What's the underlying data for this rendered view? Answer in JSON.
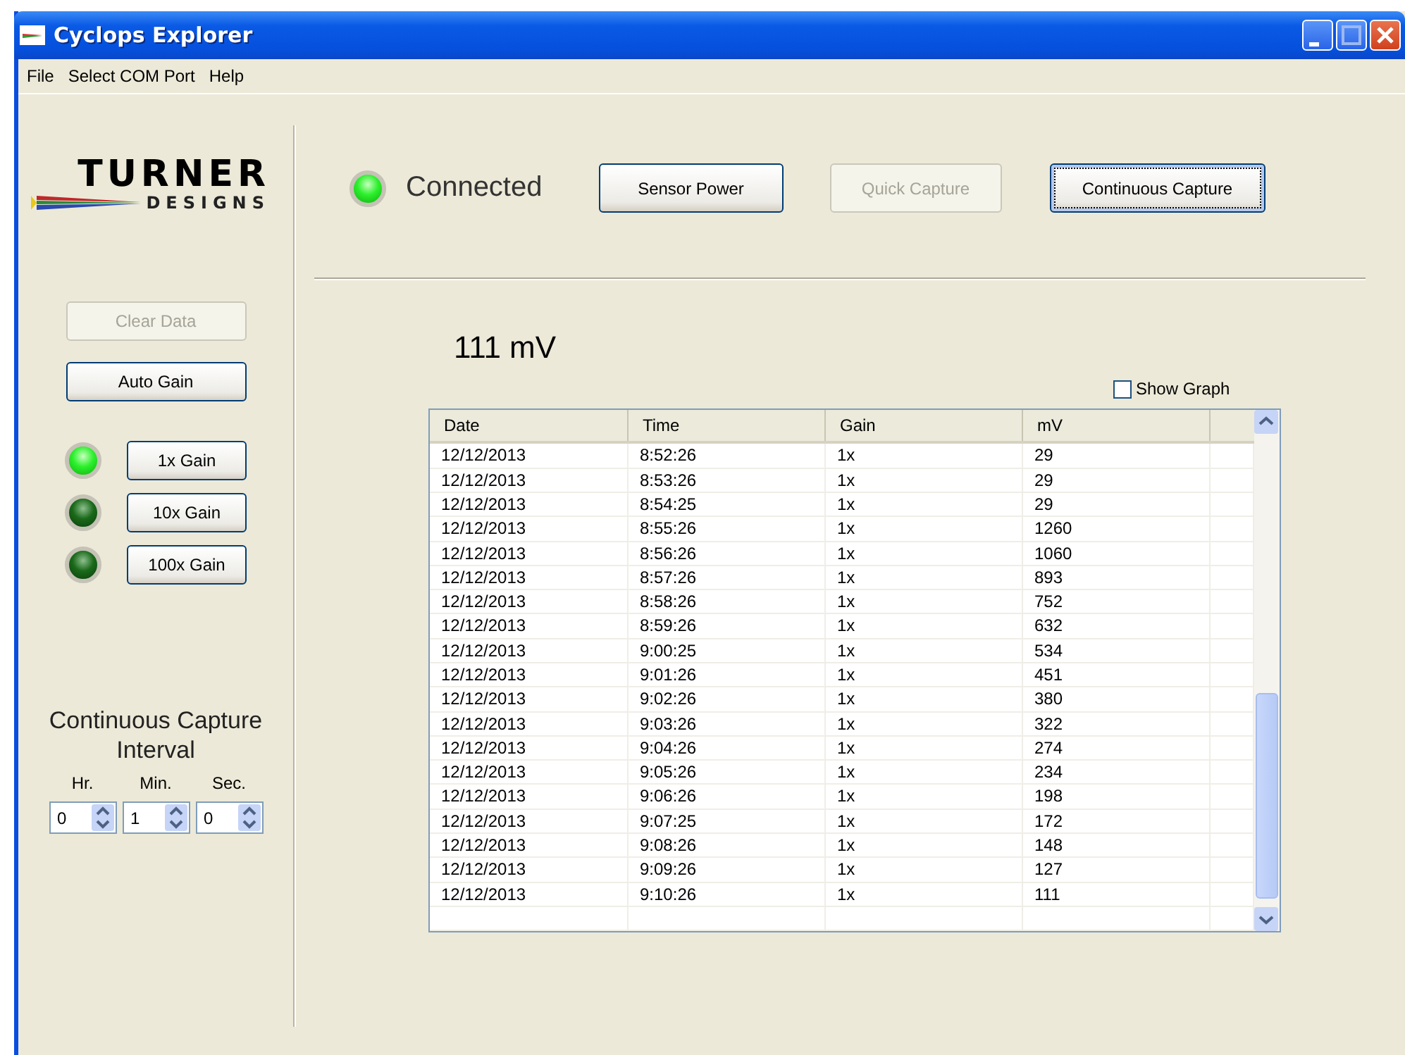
{
  "window": {
    "title": "Cyclops Explorer"
  },
  "menu": [
    "File",
    "Select COM Port",
    "Help"
  ],
  "logo": {
    "name": "TURNER",
    "subtitle": "DESIGNS"
  },
  "sidebar": {
    "buttons": [
      {
        "label": "Clear Data",
        "disabled": true
      },
      {
        "label": "Auto Gain",
        "disabled": false
      }
    ],
    "gains": [
      {
        "label": "1x Gain",
        "on": true
      },
      {
        "label": "10x Gain",
        "on": false
      },
      {
        "label": "100x Gain",
        "on": false
      }
    ],
    "interval": {
      "title": "Continuous Capture Interval",
      "fields": [
        {
          "label": "Hr.",
          "value": "0"
        },
        {
          "label": "Min.",
          "value": "1"
        },
        {
          "label": "Sec.",
          "value": "0"
        }
      ]
    }
  },
  "status": {
    "connected": true,
    "label": "Connected"
  },
  "toolbar": [
    {
      "label": "Sensor Power",
      "disabled": false,
      "focused": false
    },
    {
      "label": "Quick Capture",
      "disabled": true,
      "focused": false
    },
    {
      "label": "Continuous Capture",
      "disabled": false,
      "focused": true
    }
  ],
  "reading": "111 mV",
  "show_graph": {
    "label": "Show Graph",
    "checked": false
  },
  "table": {
    "columns": [
      "Date",
      "Time",
      "Gain",
      "mV"
    ],
    "rows": [
      [
        "12/12/2013",
        "8:52:26",
        "1x",
        "29"
      ],
      [
        "12/12/2013",
        "8:53:26",
        "1x",
        "29"
      ],
      [
        "12/12/2013",
        "8:54:25",
        "1x",
        "29"
      ],
      [
        "12/12/2013",
        "8:55:26",
        "1x",
        "1260"
      ],
      [
        "12/12/2013",
        "8:56:26",
        "1x",
        "1060"
      ],
      [
        "12/12/2013",
        "8:57:26",
        "1x",
        "893"
      ],
      [
        "12/12/2013",
        "8:58:26",
        "1x",
        "752"
      ],
      [
        "12/12/2013",
        "8:59:26",
        "1x",
        "632"
      ],
      [
        "12/12/2013",
        "9:00:25",
        "1x",
        "534"
      ],
      [
        "12/12/2013",
        "9:01:26",
        "1x",
        "451"
      ],
      [
        "12/12/2013",
        "9:02:26",
        "1x",
        "380"
      ],
      [
        "12/12/2013",
        "9:03:26",
        "1x",
        "322"
      ],
      [
        "12/12/2013",
        "9:04:26",
        "1x",
        "274"
      ],
      [
        "12/12/2013",
        "9:05:26",
        "1x",
        "234"
      ],
      [
        "12/12/2013",
        "9:06:26",
        "1x",
        "198"
      ],
      [
        "12/12/2013",
        "9:07:25",
        "1x",
        "172"
      ],
      [
        "12/12/2013",
        "9:08:26",
        "1x",
        "148"
      ],
      [
        "12/12/2013",
        "9:09:26",
        "1x",
        "127"
      ],
      [
        "12/12/2013",
        "9:10:26",
        "1x",
        "111"
      ]
    ]
  }
}
